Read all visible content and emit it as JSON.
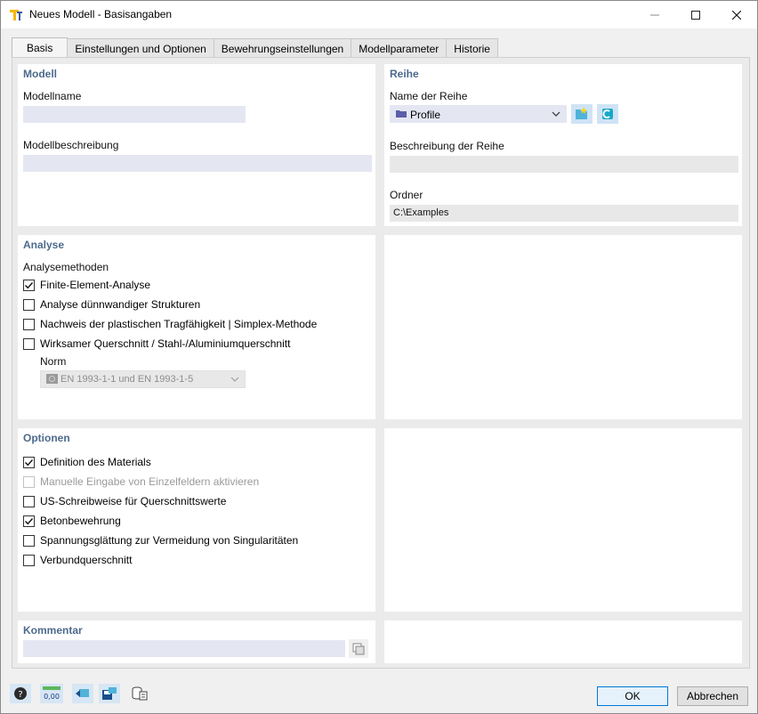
{
  "window": {
    "title": "Neues Modell - Basisangaben"
  },
  "tabs": [
    {
      "label": "Basis"
    },
    {
      "label": "Einstellungen und Optionen"
    },
    {
      "label": "Bewehrungseinstellungen"
    },
    {
      "label": "Modellparameter"
    },
    {
      "label": "Historie"
    }
  ],
  "modell": {
    "title": "Modell",
    "name_label": "Modellname",
    "name_value": "",
    "desc_label": "Modellbeschreibung",
    "desc_value": ""
  },
  "reihe": {
    "title": "Reihe",
    "name_label": "Name der Reihe",
    "name_value": "Profile",
    "desc_label": "Beschreibung der Reihe",
    "desc_value": "",
    "folder_label": "Ordner",
    "folder_value": "C:\\Examples"
  },
  "analyse": {
    "title": "Analyse",
    "methods_label": "Analysemethoden",
    "options": [
      {
        "label": "Finite-Element-Analyse",
        "checked": true
      },
      {
        "label": "Analyse dünnwandiger Strukturen",
        "checked": false
      },
      {
        "label": "Nachweis der plastischen Tragfähigkeit | Simplex-Methode",
        "checked": false
      },
      {
        "label": "Wirksamer Querschnitt / Stahl-/Aluminiumquerschnitt",
        "checked": false
      }
    ],
    "norm_label": "Norm",
    "norm_value": "EN 1993-1-1 und EN 1993-1-5"
  },
  "optionen": {
    "title": "Optionen",
    "options": [
      {
        "label": "Definition des Materials",
        "checked": true,
        "disabled": false
      },
      {
        "label": "Manuelle Eingabe von Einzelfeldern aktivieren",
        "checked": false,
        "disabled": true
      },
      {
        "label": "US-Schreibweise für Querschnittswerte",
        "checked": false,
        "disabled": false
      },
      {
        "label": "Betonbewehrung",
        "checked": true,
        "disabled": false
      },
      {
        "label": "Spannungsglättung zur Vermeidung von Singularitäten",
        "checked": false,
        "disabled": false
      },
      {
        "label": "Verbundquerschnitt",
        "checked": false,
        "disabled": false
      }
    ]
  },
  "kommentar": {
    "title": "Kommentar",
    "value": ""
  },
  "footer": {
    "units_icon_text": "0,00",
    "ok_label": "OK",
    "cancel_label": "Abbrechen"
  },
  "colors": {
    "section_title": "#4d6a8c",
    "field_bg": "#e4e7f2",
    "accent": "#0078d7"
  }
}
